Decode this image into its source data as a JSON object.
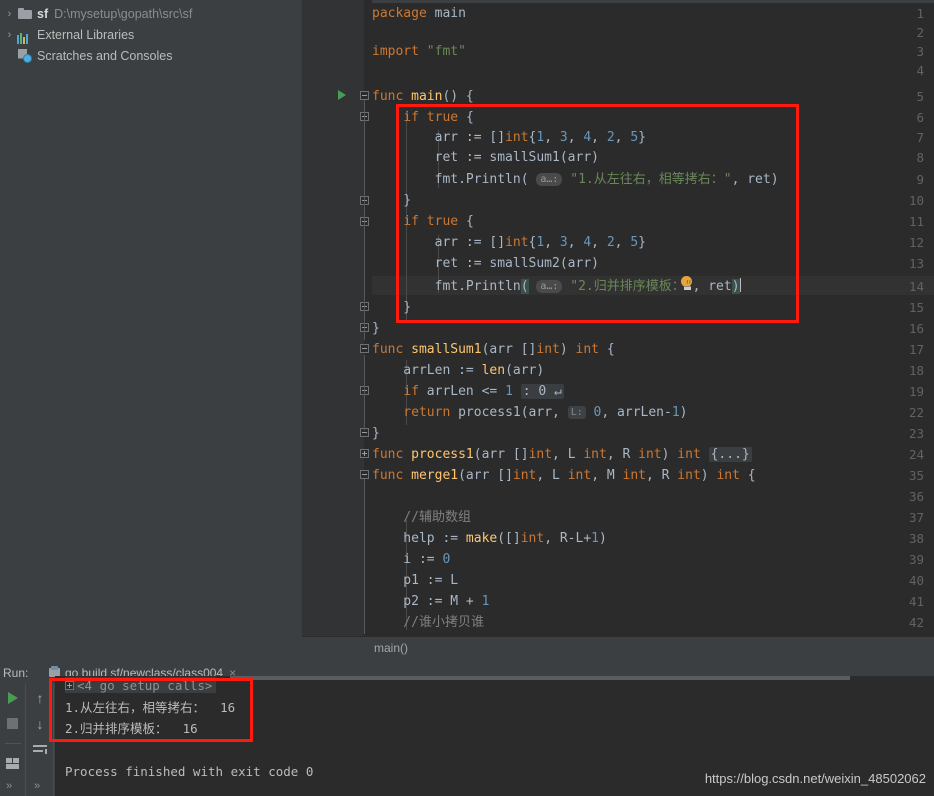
{
  "project_tree": {
    "items": [
      {
        "arrow": "›",
        "icon": "folder-icon",
        "name": "sf",
        "path": "D:\\mysetup\\gopath\\src\\sf"
      },
      {
        "arrow": "›",
        "icon": "library-bars-icon",
        "name": "External Libraries",
        "path": ""
      },
      {
        "arrow": "",
        "icon": "scratches-clock-icon",
        "name": "Scratches and Consoles",
        "path": ""
      }
    ]
  },
  "editor": {
    "breadcrumb": "main()",
    "lines": [
      {
        "no": "1",
        "text": "package main"
      },
      {
        "no": "2",
        "text": ""
      },
      {
        "no": "3",
        "text": "import \"fmt\""
      },
      {
        "no": "4",
        "text": ""
      },
      {
        "no": "5",
        "text": "func main() {"
      },
      {
        "no": "6",
        "text": "    if true {"
      },
      {
        "no": "7",
        "text": "        arr := []int{1, 3, 4, 2, 5}"
      },
      {
        "no": "8",
        "text": "        ret := smallSum1(arr)"
      },
      {
        "no": "9",
        "text": "        fmt.Println( a…: \"1.从左往右，相等拷右：\", ret)"
      },
      {
        "no": "10",
        "text": "    }"
      },
      {
        "no": "11",
        "text": "    if true {"
      },
      {
        "no": "12",
        "text": "        arr := []int{1, 3, 4, 2, 5}"
      },
      {
        "no": "13",
        "text": "        ret := smallSum2(arr)"
      },
      {
        "no": "14",
        "text": "        fmt.Println( a…: \"2.归并排序模板：\", ret)"
      },
      {
        "no": "15",
        "text": "    }"
      },
      {
        "no": "16",
        "text": "}"
      },
      {
        "no": "17",
        "text": "func smallSum1(arr []int) int {"
      },
      {
        "no": "18",
        "text": "    arrLen := len(arr)"
      },
      {
        "no": "19",
        "text": "    if arrLen <= 1 : 0 ↵"
      },
      {
        "no": "22",
        "text": "    return process1(arr,  L: 0, arrLen-1)"
      },
      {
        "no": "23",
        "text": "}"
      },
      {
        "no": "24",
        "text": "func process1(arr []int, L int, R int) int {...}"
      },
      {
        "no": "35",
        "text": "func merge1(arr []int, L int, M int, R int) int {"
      },
      {
        "no": "36",
        "text": ""
      },
      {
        "no": "37",
        "text": "    //辅助数组"
      },
      {
        "no": "38",
        "text": "    help := make([]int, R-L+1)"
      },
      {
        "no": "39",
        "text": "    i := 0"
      },
      {
        "no": "40",
        "text": "    p1 := L"
      },
      {
        "no": "41",
        "text": "    p2 := M + 1"
      },
      {
        "no": "42",
        "text": "    //谁小拷贝谁"
      }
    ],
    "inlay_hints": {
      "arg_hint": "a…:",
      "l_hint": "L:"
    },
    "fold_placeholders": {
      "process1_body": "{...}",
      "if_body": ": 0 ↵"
    },
    "gutter_run_icon": "run-triangle-icon",
    "gutter_bulb_icon": "intention-bulb-icon"
  },
  "run_panel": {
    "label": "Run:",
    "tab_title": "go build sf/newclass/class004",
    "tab_close": "×",
    "toolbar": {
      "rerun": "rerun-button",
      "stop": "stop-button",
      "layout": "layout-button",
      "up": "↑",
      "down": "↓",
      "wrap": "soft-wrap-button",
      "expand_left": "»",
      "expand_right": "»"
    },
    "console": {
      "collapsed_calls": "<4 go setup calls>",
      "output": [
        "1.从左往右，相等拷右：  16",
        "2.归并排序模板：  16"
      ],
      "status": "Process finished with exit code 0"
    }
  },
  "watermark": "https://blog.csdn.net/weixin_48502062",
  "colors": {
    "editor_bg": "#2b2b2b",
    "panel_bg": "#3c3f41",
    "gutter_bg": "#313335",
    "keyword": "#cc7832",
    "string": "#6a8759",
    "number": "#6897bb",
    "function": "#ffc66d",
    "identifier": "#a9b7c6",
    "comment": "#808080",
    "annotation_red": "#ff1a0d",
    "run_green": "#499c54"
  }
}
